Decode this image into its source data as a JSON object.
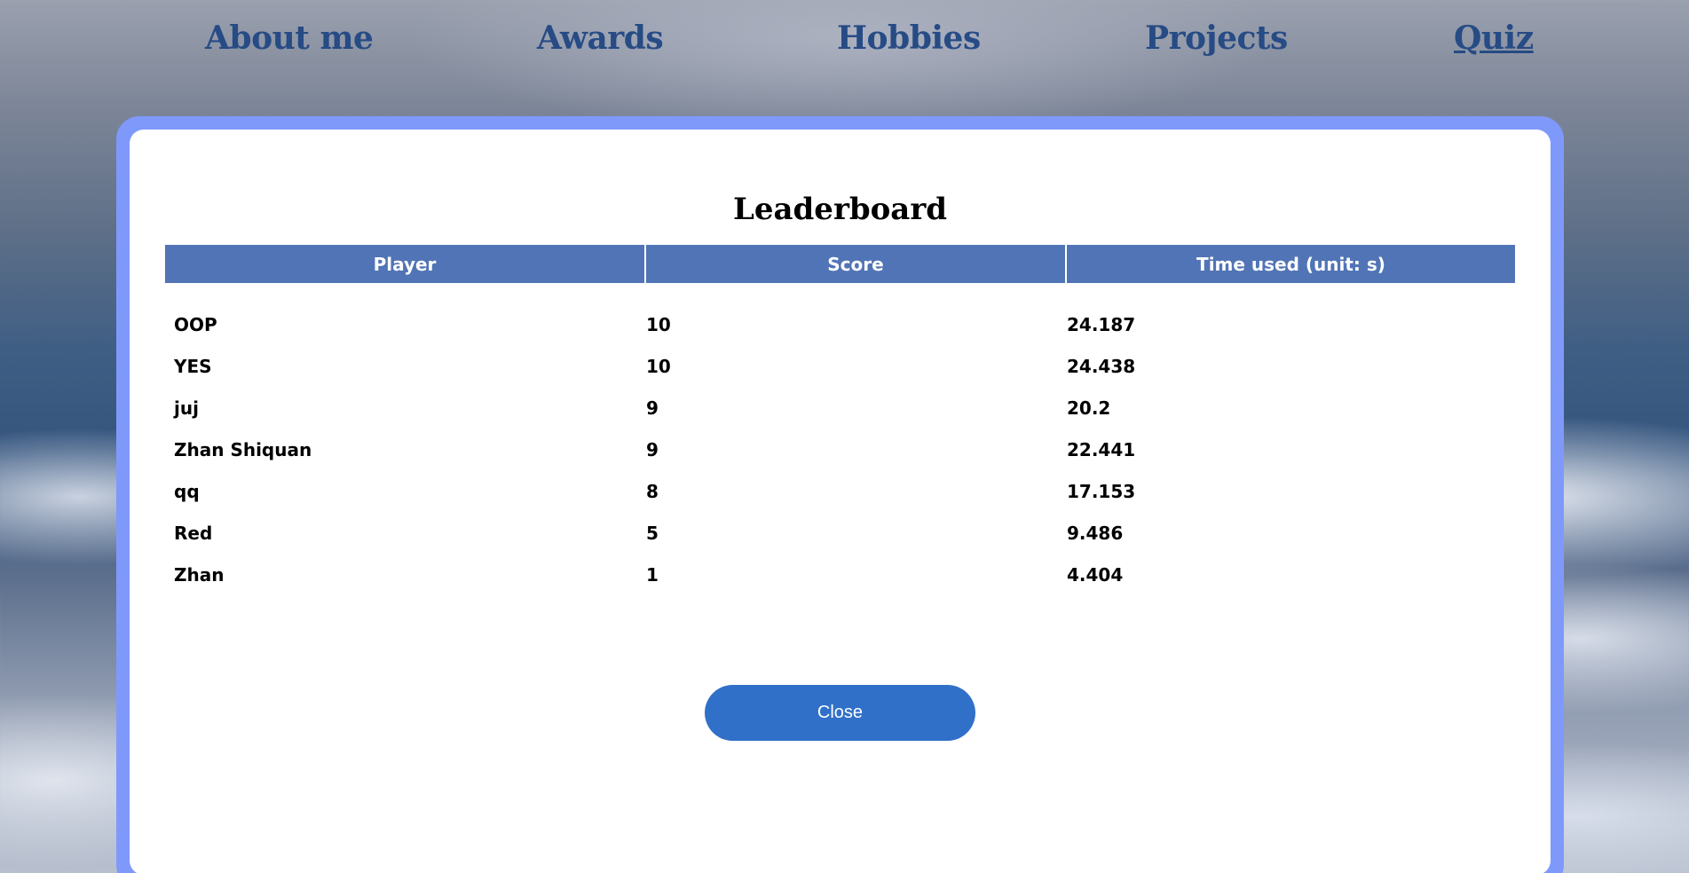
{
  "nav": {
    "items": [
      {
        "label": "About me"
      },
      {
        "label": "Awards"
      },
      {
        "label": "Hobbies"
      },
      {
        "label": "Projects"
      },
      {
        "label": "Quiz",
        "active": true
      }
    ]
  },
  "modal": {
    "title": "Leaderboard",
    "table": {
      "headers": [
        "Player",
        "Score",
        "Time used (unit: s)"
      ],
      "rows": [
        [
          "OOP",
          "10",
          "24.187"
        ],
        [
          "YES",
          "10",
          "24.438"
        ],
        [
          "juj",
          "9",
          "20.2"
        ],
        [
          "Zhan Shiquan",
          "9",
          "22.441"
        ],
        [
          "qq",
          "8",
          "17.153"
        ],
        [
          "Red",
          "5",
          "9.486"
        ],
        [
          "Zhan",
          "1",
          "4.404"
        ]
      ]
    },
    "close_label": "Close"
  },
  "colors": {
    "nav_link": "#264b85",
    "modal_border": "#7f99fb",
    "table_header": "#5174b6",
    "close_button": "#3070c8"
  }
}
